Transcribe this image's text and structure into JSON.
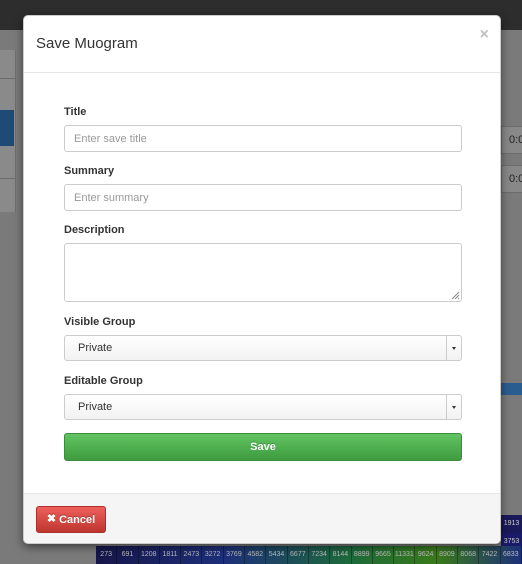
{
  "modal": {
    "title": "Save Muogram",
    "close_glyph": "×"
  },
  "form": {
    "title_label": "Title",
    "title_placeholder": "Enter save title",
    "summary_label": "Summary",
    "summary_placeholder": "Enter summary",
    "description_label": "Description",
    "visible_group_label": "Visible Group",
    "visible_group_value": "Private",
    "editable_group_label": "Editable Group",
    "editable_group_value": "Private",
    "save_label": "Save"
  },
  "footer": {
    "cancel_glyph": "✖",
    "cancel_label": "Cancel"
  },
  "background": {
    "side_value_1": "0:0",
    "side_value_2": "0:0",
    "grid_side_values": [
      "1913",
      "3753",
      "5470"
    ],
    "grid_rows": [
      [
        "273",
        "691",
        "1208",
        "1811",
        "2473",
        "3272",
        "3769",
        "4582",
        "5434",
        "6677",
        "7234",
        "8144",
        "8899",
        "9665",
        "11331",
        "9624",
        "8909",
        "8068",
        "7422",
        "6833"
      ]
    ]
  },
  "colors": {
    "save_green": "#51a351",
    "cancel_red": "#da4f49",
    "overlay": "#6b6b6b"
  },
  "icons": {
    "close": "close-icon",
    "cancel": "x-icon",
    "select_arrow": "caret-down-icon",
    "resize": "resize-grip-icon"
  }
}
